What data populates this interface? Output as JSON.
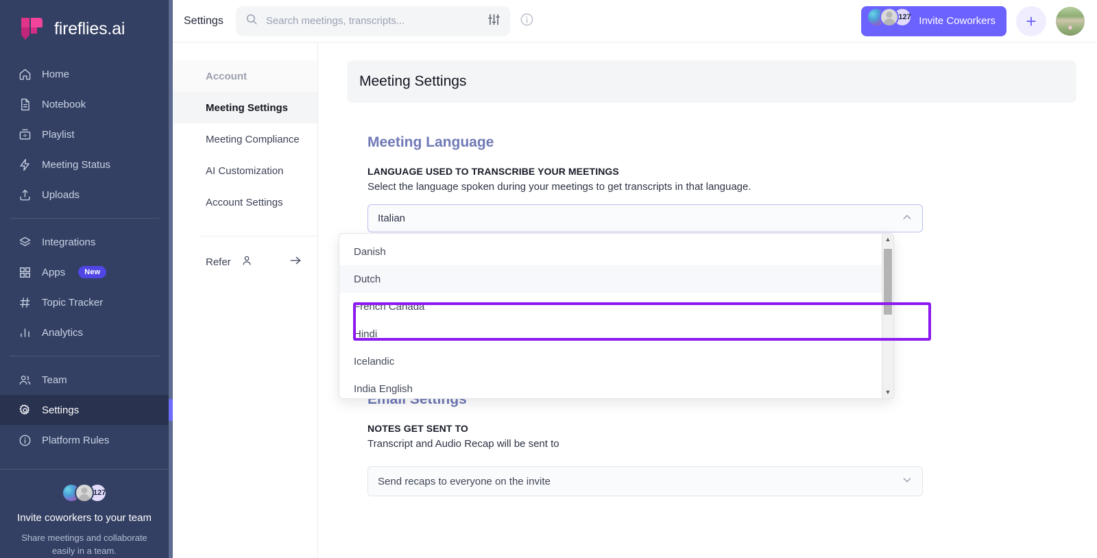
{
  "app": {
    "brand": "fireflies.ai"
  },
  "sidebar": {
    "items": [
      {
        "label": "Home",
        "icon": "home-icon"
      },
      {
        "label": "Notebook",
        "icon": "notebook-icon"
      },
      {
        "label": "Playlist",
        "icon": "playlist-icon"
      },
      {
        "label": "Meeting Status",
        "icon": "bolt-icon"
      },
      {
        "label": "Uploads",
        "icon": "upload-icon"
      }
    ],
    "items2": [
      {
        "label": "Integrations",
        "icon": "layers-icon"
      },
      {
        "label": "Apps",
        "icon": "grid-icon",
        "badge": "New"
      },
      {
        "label": "Topic Tracker",
        "icon": "hash-icon"
      },
      {
        "label": "Analytics",
        "icon": "bar-chart-icon"
      }
    ],
    "items3": [
      {
        "label": "Team",
        "icon": "people-icon"
      },
      {
        "label": "Settings",
        "icon": "gear-icon",
        "active": true
      },
      {
        "label": "Platform Rules",
        "icon": "info-circle-icon"
      }
    ],
    "invite": {
      "count": "+127",
      "title": "Invite coworkers to your team",
      "subtitle": "Share meetings and collaborate easily in a team."
    }
  },
  "topbar": {
    "title": "Settings",
    "search_placeholder": "Search meetings, transcripts...",
    "filter_icon": "sliders-icon",
    "info_icon": "info-circle-icon",
    "invite_label": "Invite Coworkers",
    "invite_count": "+127",
    "plus_label": "+"
  },
  "subnav": {
    "header": "Account",
    "items": [
      {
        "label": "Meeting Settings",
        "active": true
      },
      {
        "label": "Meeting Compliance",
        "active": false
      },
      {
        "label": "AI Customization",
        "active": false
      },
      {
        "label": "Account Settings",
        "active": false
      }
    ],
    "refer": {
      "label": "Refer",
      "person_icon": "person-icon",
      "arrow_icon": "arrow-right-icon"
    }
  },
  "pane": {
    "header": "Meeting Settings",
    "language": {
      "section_title": "Meeting Language",
      "field_label": "LANGUAGE USED TO TRANSCRIBE YOUR MEETINGS",
      "field_desc": "Select the language spoken during your meetings to get transcripts in that language.",
      "selected": "Italian",
      "chevron": "chevron-up-icon",
      "options": [
        "Danish",
        "Dutch",
        "French Canada",
        "Hindi",
        "Icelandic",
        "India English"
      ],
      "hovered_option": "Dutch"
    },
    "email": {
      "section_title": "Email Settings",
      "field_label": "NOTES GET SENT TO",
      "field_desc": "Transcript and Audio Recap will be sent to",
      "selected": "Send recaps to everyone on the invite",
      "chevron": "chevron-down-icon"
    }
  },
  "colors": {
    "sidebar_bg": "#344063",
    "accent_purple": "#6c63ff",
    "highlight_outline": "#8b19f0",
    "section_heading": "#6f79b6",
    "brand_pink": "#e0348a"
  }
}
